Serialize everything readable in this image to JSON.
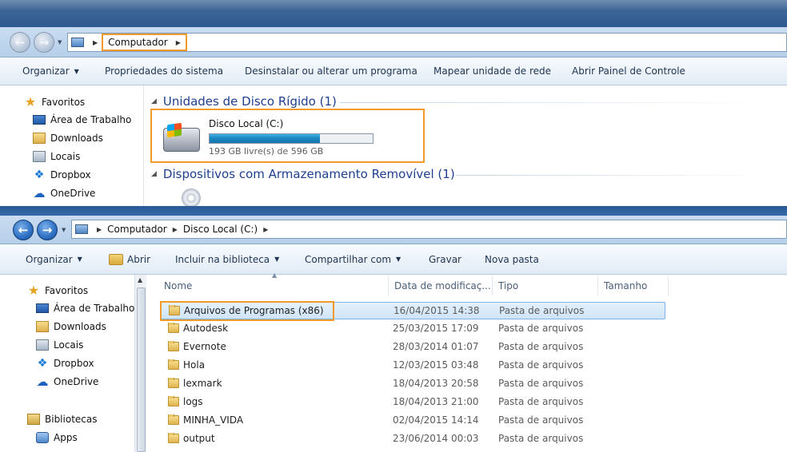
{
  "top_window": {
    "breadcrumb": [
      "Computador"
    ],
    "toolbar": [
      "Organizar",
      "Propriedades do sistema",
      "Desinstalar ou alterar um programa",
      "Mapear unidade de rede",
      "Abrir Painel de Controle"
    ],
    "nav": [
      {
        "label": "Favoritos",
        "icon": "star-icon"
      },
      {
        "label": "Área de Trabalho",
        "icon": "desktop-icon"
      },
      {
        "label": "Downloads",
        "icon": "downloads-folder-icon"
      },
      {
        "label": "Locais",
        "icon": "places-icon"
      },
      {
        "label": "Dropbox",
        "icon": "dropbox-icon"
      },
      {
        "label": "OneDrive",
        "icon": "onedrive-icon"
      }
    ],
    "groups": {
      "hdd": "Unidades de Disco Rígido (1)",
      "removable": "Dispositivos com Armazenamento Removível (1)"
    },
    "drive": {
      "name": "Disco Local (C:)",
      "free_text": "193 GB livre(s) de 596 GB",
      "used_fraction": 0.676
    }
  },
  "bottom_window": {
    "breadcrumb": [
      "Computador",
      "Disco Local (C:)"
    ],
    "toolbar": [
      "Organizar",
      "Abrir",
      "Incluir na biblioteca",
      "Compartilhar com",
      "Gravar",
      "Nova pasta"
    ],
    "nav": [
      {
        "label": "Favoritos",
        "icon": "star-icon"
      },
      {
        "label": "Área de Trabalho",
        "icon": "desktop-icon"
      },
      {
        "label": "Downloads",
        "icon": "downloads-folder-icon"
      },
      {
        "label": "Locais",
        "icon": "places-icon"
      },
      {
        "label": "Dropbox",
        "icon": "dropbox-icon"
      },
      {
        "label": "OneDrive",
        "icon": "onedrive-icon"
      },
      {
        "label": "Bibliotecas",
        "icon": "libraries-icon"
      },
      {
        "label": "Apps",
        "icon": "apps-icon"
      }
    ],
    "columns": [
      "Nome",
      "Data de modificaç...",
      "Tipo",
      "Tamanho"
    ],
    "rows": [
      {
        "name": "Arquivos de Programas (x86)",
        "date": "16/04/2015 14:38",
        "type": "Pasta de arquivos"
      },
      {
        "name": "Autodesk",
        "date": "25/03/2015 17:09",
        "type": "Pasta de arquivos"
      },
      {
        "name": "Evernote",
        "date": "28/03/2014 01:07",
        "type": "Pasta de arquivos"
      },
      {
        "name": "Hola",
        "date": "12/03/2015 03:48",
        "type": "Pasta de arquivos"
      },
      {
        "name": "lexmark",
        "date": "18/04/2013 20:58",
        "type": "Pasta de arquivos"
      },
      {
        "name": "logs",
        "date": "18/04/2013 21:00",
        "type": "Pasta de arquivos"
      },
      {
        "name": "MINHA_VIDA",
        "date": "02/04/2015 14:14",
        "type": "Pasta de arquivos"
      },
      {
        "name": "output",
        "date": "23/06/2014 00:03",
        "type": "Pasta de arquivos"
      }
    ]
  },
  "colors": {
    "highlight": "#f39a2c",
    "group_heading": "#1e3f8f",
    "progress_fill": "#1a84bd",
    "selection": "#cfe4f8"
  }
}
